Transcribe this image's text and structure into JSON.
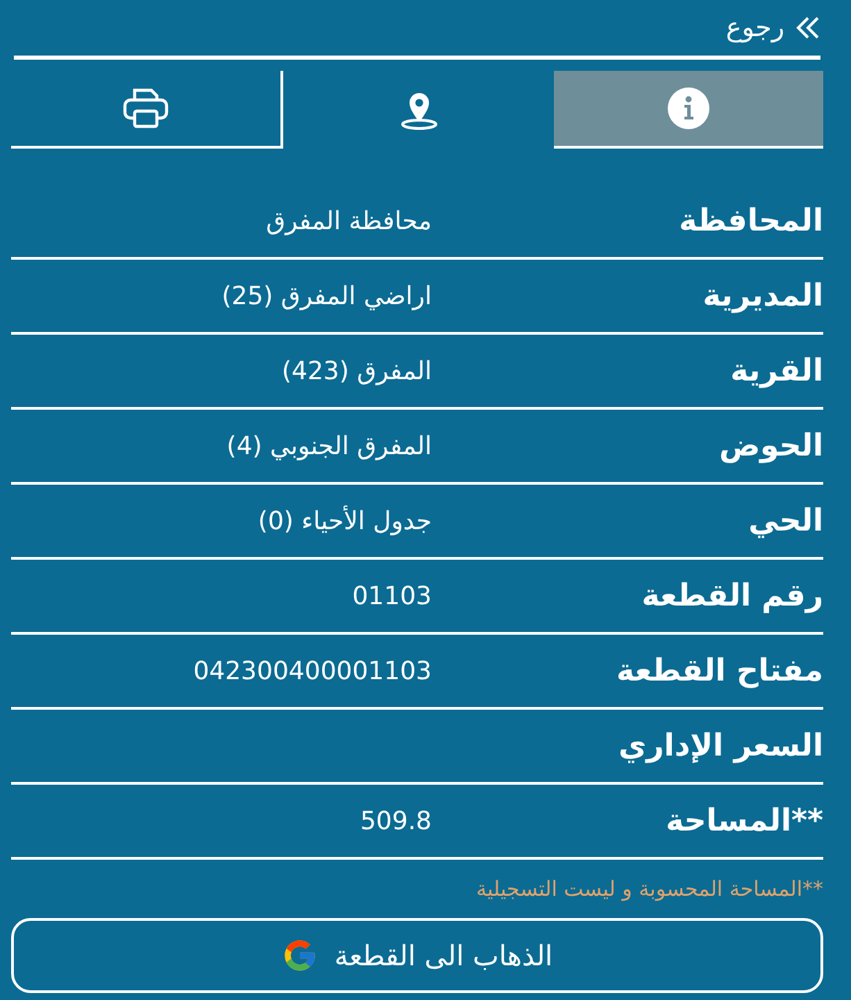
{
  "back_link": {
    "label": "رجوع"
  },
  "tabs": [
    {
      "kind": "info",
      "selected": true
    },
    {
      "kind": "location",
      "selected": false
    },
    {
      "kind": "print",
      "selected": false
    }
  ],
  "rows": [
    {
      "label": "المحافظة",
      "value": "محافظة المفرق"
    },
    {
      "label": "المديرية",
      "value": "اراضي المفرق (25)"
    },
    {
      "label": "القرية",
      "value": "المفرق (423)"
    },
    {
      "label": "الحوض",
      "value": "المفرق الجنوبي (4)"
    },
    {
      "label": "الحي",
      "value": "جدول الأحياء (0)"
    },
    {
      "label": "رقم القطعة",
      "value": "01103"
    },
    {
      "label": "مفتاح القطعة",
      "value": "042300400001103"
    },
    {
      "label": "السعر الإداري"
    },
    {
      "label": "**المساحة",
      "value": "509.8"
    }
  ],
  "note": "**المساحة المحسوبة و ليست التسجيلية",
  "map_button": {
    "label": "الذهاب الى القطعة"
  }
}
